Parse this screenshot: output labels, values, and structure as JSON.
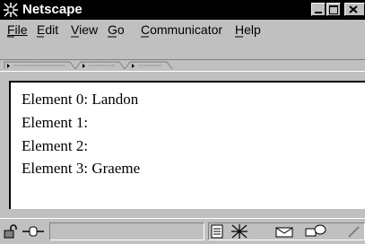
{
  "window": {
    "title": "Netscape"
  },
  "menu": {
    "file_label": "File",
    "edit_label": "Edit",
    "view_label": "View",
    "go_label": "Go",
    "communicator_label": "Communicator",
    "help_label": "Help"
  },
  "content": {
    "lines": [
      "Element 0: Landon",
      "Element 1:",
      "Element 2:",
      "Element 3: Graeme"
    ]
  },
  "icons": {
    "app": "netscape-icon",
    "status": [
      "lock-icon",
      "connection-icon",
      "component-icon",
      "mail-icon",
      "discussion-icon",
      "composer-icon"
    ]
  }
}
